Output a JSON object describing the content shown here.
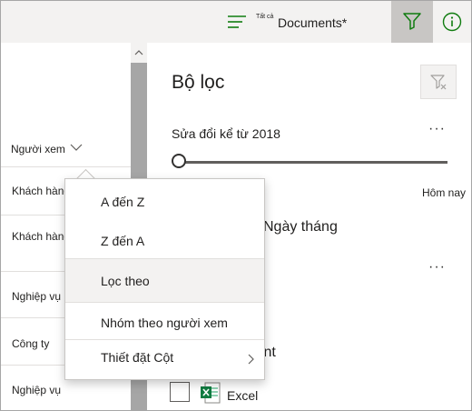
{
  "header": {
    "view_small_label": "Tất cả",
    "view_title": "Documents*",
    "icons": {
      "view": "view-list-icon",
      "filter": "filter-icon",
      "info": "info-icon"
    }
  },
  "left_column": {
    "column_header": "Người xem",
    "rows": [
      "Khách hàng",
      "Khách hàng",
      "Nghiệp vụ",
      "Công ty",
      "Nghiệp vụ"
    ]
  },
  "filter_panel": {
    "title": "Bộ lọc",
    "modified_label": "Sửa đổi kể từ 2018",
    "slider_value": 0,
    "slider_end_label": "Hôm nay",
    "date_section_label": "Ngày tháng",
    "filetype_partial": "rPoint",
    "excel_label": "Excel",
    "more_glyph": "···"
  },
  "context_menu": {
    "items": [
      "A đến Z",
      "Z đến A",
      "Lọc theo",
      "Nhóm theo người xem",
      "Thiết đặt Cột"
    ],
    "selected_index": 2
  },
  "colors": {
    "header_bg": "#f3f2f1",
    "filter_active_bg": "#c8c6c4",
    "accent_green": "#107c10",
    "scrollbar": "#a6a6a6"
  }
}
